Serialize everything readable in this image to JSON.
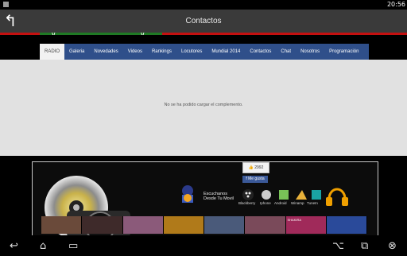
{
  "status_bar": {
    "time": "20:56"
  },
  "action_bar": {
    "title": "Contactos",
    "back_icon": "back-arrow-icon"
  },
  "nav": {
    "items": [
      {
        "label": "RADIO",
        "active": true
      },
      {
        "label": "Galeria"
      },
      {
        "label": "Novedades"
      },
      {
        "label": "Videos"
      },
      {
        "label": "Rankings"
      },
      {
        "label": "Locutores"
      },
      {
        "label": "Mundial 2014"
      },
      {
        "label": "Contactos"
      },
      {
        "label": "Chat"
      },
      {
        "label": "Nosotros"
      },
      {
        "label": "Programación"
      }
    ]
  },
  "plugin": {
    "message": "No se ha podido cargar el complemento."
  },
  "promo": {
    "like_count": "2992",
    "fb_button": "Me gusta",
    "listen_line1": "Escuchanos",
    "listen_line2": "Desde Tu Movil",
    "apps": [
      "Blackberry",
      "Iphone",
      "Android",
      "Winamp",
      "TuneIn"
    ],
    "thumbs": [
      "",
      "",
      "",
      "",
      "",
      "",
      "SHAKIRA",
      ""
    ]
  },
  "colors": {
    "nav_bg": "#2f4f8a",
    "accent": "#c41010",
    "fb": "#3b5998"
  }
}
